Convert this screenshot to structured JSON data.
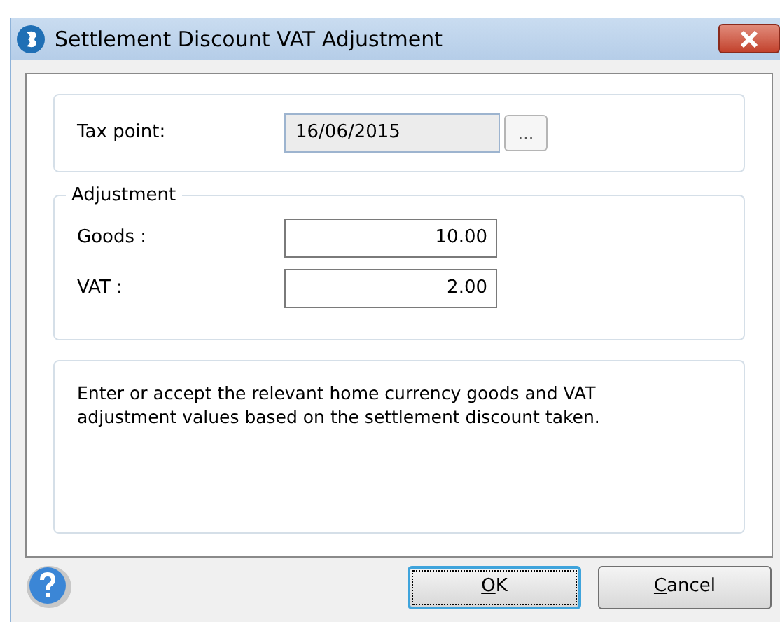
{
  "window": {
    "title": "Settlement Discount VAT Adjustment"
  },
  "tax_point": {
    "label": "Tax point:",
    "value": "16/06/2015",
    "picker": "..."
  },
  "adjustment": {
    "title": "Adjustment",
    "fields": [
      {
        "label": "Goods :",
        "value": "10.00"
      },
      {
        "label": "VAT :",
        "value": "2.00"
      }
    ]
  },
  "info": "Enter or accept the relevant home currency goods and VAT adjustment values based on the settlement discount taken.",
  "buttons": [
    {
      "key": "O",
      "rest": "K",
      "default": true
    },
    {
      "key": "C",
      "rest": "ancel",
      "default": false
    }
  ]
}
